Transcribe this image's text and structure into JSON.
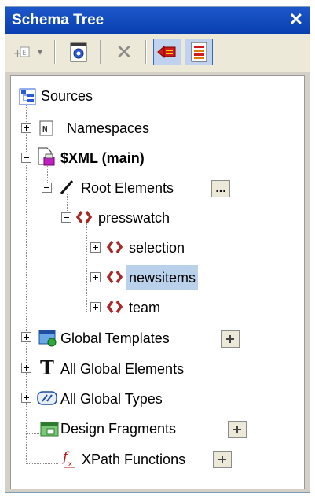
{
  "panel": {
    "title": "Schema Tree",
    "close_glyph": "✕"
  },
  "toolbar": {
    "buttons": [
      {
        "icon": "add-element-icon",
        "label": "add"
      },
      {
        "icon": "dropdown-arrow-icon",
        "label": "▾"
      },
      {
        "icon": "open-schema-icon",
        "label": ""
      },
      {
        "icon": "delete-icon",
        "label": "✕"
      },
      {
        "icon": "toggle-left-icon",
        "label": ""
      },
      {
        "icon": "toggle-list-icon",
        "label": ""
      }
    ]
  },
  "tree": {
    "root": "Sources",
    "namespaces": "Namespaces",
    "xml_main": "$XML (main)",
    "root_elements": "Root Elements",
    "root_elements_btn": "...",
    "presswatch": "presswatch",
    "selection": "selection",
    "newsitems": "newsitems",
    "team": "team",
    "global_templates": "Global Templates",
    "all_global_elements": "All Global Elements",
    "all_global_types": "All Global Types",
    "design_fragments": "Design Fragments",
    "xpath_functions": "XPath Functions"
  },
  "colors": {
    "title_bar": "#0a3fb0",
    "selection": "#b9d1ea",
    "element_icon": "#a52a2a"
  }
}
